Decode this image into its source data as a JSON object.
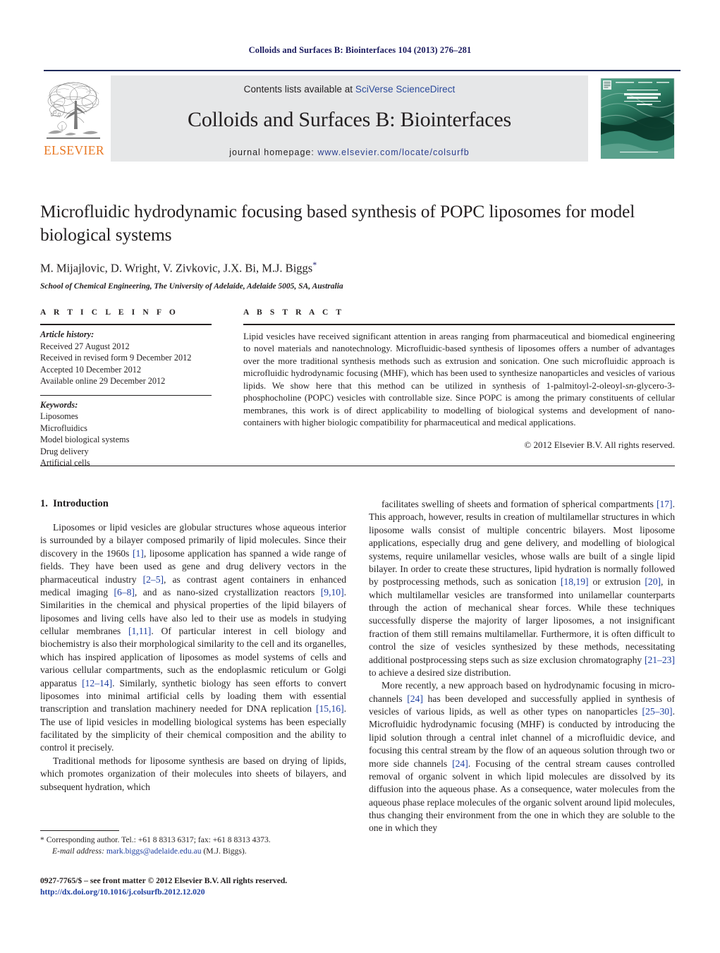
{
  "running_head": "Colloids and Surfaces B: Biointerfaces 104 (2013) 276–281",
  "masthead": {
    "publisher_name": "ELSEVIER",
    "contents_prefix": "Contents lists available at ",
    "contents_link": "SciVerse ScienceDirect",
    "journal_title": "Colloids and Surfaces B: Biointerfaces",
    "homepage_prefix": "journal homepage: ",
    "homepage_url": "www.elsevier.com/locate/colsurfb",
    "cover_line1": "COLLOIDS AND",
    "cover_line2": "SURFACES B",
    "cover_line3": "Biointerfaces",
    "colors": {
      "elsevier_orange": "#E87722",
      "link_blue": "#2b4a9b",
      "banner_grey": "#e6e7e8",
      "rule_navy": "#1f2a5a",
      "cover_green": "#2e8b6f"
    }
  },
  "title": "Microfluidic hydrodynamic focusing based synthesis of POPC liposomes for model biological systems",
  "authors": "M. Mijajlovic, D. Wright, V. Zivkovic, J.X. Bi, M.J. Biggs",
  "corresponding_marker": "*",
  "affiliation": "School of Chemical Engineering, The University of Adelaide, Adelaide 5005, SA, Australia",
  "article_info": {
    "label": "A R T I C L E   I N F O",
    "history_heading": "Article history:",
    "history": [
      "Received 27 August 2012",
      "Received in revised form 9 December 2012",
      "Accepted 10 December 2012",
      "Available online 29 December 2012"
    ],
    "keywords_heading": "Keywords:",
    "keywords": [
      "Liposomes",
      "Microfluidics",
      "Model biological systems",
      "Drug delivery",
      "Artificial cells"
    ]
  },
  "abstract": {
    "label": "A B S T R A C T",
    "part1": "Lipid vesicles have received significant attention in areas ranging from pharmaceutical and biomedical engineering to novel materials and nanotechnology. Microfluidic-based synthesis of liposomes offers a number of advantages over the more traditional synthesis methods such as extrusion and sonication. One such microfluidic approach is microfluidic hydrodynamic focusing (MHF), which has been used to synthesize nanoparticles and vesicles of various lipids. We show here that this method can be utilized in synthesis of 1-palmitoyl-2-oleoyl-",
    "italic_token": "sn",
    "part2": "-glycero-3-phosphocholine (POPC) vesicles with controllable size. Since POPC is among the primary constituents of cellular membranes, this work is of direct applicability to modelling of biological systems and development of nano-containers with higher biologic compatibility for pharmaceutical and medical applications.",
    "copyright": "© 2012 Elsevier B.V. All rights reserved."
  },
  "body": {
    "section_number": "1.",
    "section_title": "Introduction",
    "left_paragraphs": [
      {
        "segments": [
          {
            "t": "Liposomes or lipid vesicles are globular structures whose aqueous interior is surrounded by a bilayer composed primarily of lipid molecules. Since their discovery in the 1960s "
          },
          {
            "t": "[1]",
            "cite": true
          },
          {
            "t": ", liposome application has spanned a wide range of fields. They have been used as gene and drug delivery vectors in the pharmaceutical industry "
          },
          {
            "t": "[2–5]",
            "cite": true
          },
          {
            "t": ", as contrast agent containers in enhanced medical imaging "
          },
          {
            "t": "[6–8]",
            "cite": true
          },
          {
            "t": ", and as nano-sized crystallization reactors "
          },
          {
            "t": "[9,10]",
            "cite": true
          },
          {
            "t": ". Similarities in the chemical and physical properties of the lipid bilayers of liposomes and living cells have also led to their use as models in studying cellular membranes "
          },
          {
            "t": "[1,11]",
            "cite": true
          },
          {
            "t": ". Of particular interest in cell biology and biochemistry is also their morphological similarity to the cell and its organelles, which has inspired application of liposomes as model systems of cells and various cellular compartments, such as the endoplasmic reticulum or Golgi apparatus "
          },
          {
            "t": "[12–14]",
            "cite": true
          },
          {
            "t": ". Similarly, synthetic biology has seen efforts to convert liposomes into minimal artificial cells by loading them with essential transcription and translation machinery needed for DNA replication "
          },
          {
            "t": "[15,16]",
            "cite": true
          },
          {
            "t": ". The use of lipid vesicles in modelling biological systems has been especially facilitated by the simplicity of their chemical composition and the ability to control it precisely."
          }
        ]
      },
      {
        "segments": [
          {
            "t": "Traditional methods for liposome synthesis are based on drying of lipids, which promotes organization of their molecules into sheets of bilayers, and subsequent hydration, which"
          }
        ]
      }
    ],
    "right_paragraphs": [
      {
        "segments": [
          {
            "t": "facilitates swelling of sheets and formation of spherical compartments "
          },
          {
            "t": "[17]",
            "cite": true
          },
          {
            "t": ". This approach, however, results in creation of multilamellar structures in which liposome walls consist of multiple concentric bilayers. Most liposome applications, especially drug and gene delivery, and modelling of biological systems, require unilamellar vesicles, whose walls are built of a single lipid bilayer. In order to create these structures, lipid hydration is normally followed by postprocessing methods, such as sonication "
          },
          {
            "t": "[18,19]",
            "cite": true
          },
          {
            "t": " or extrusion "
          },
          {
            "t": "[20]",
            "cite": true
          },
          {
            "t": ", in which multilamellar vesicles are transformed into unilamellar counterparts through the action of mechanical shear forces. While these techniques successfully disperse the majority of larger liposomes, a not insignificant fraction of them still remains multilamellar. Furthermore, it is often difficult to control the size of vesicles synthesized by these methods, necessitating additional postprocessing steps such as size exclusion chromatography "
          },
          {
            "t": "[21–23]",
            "cite": true
          },
          {
            "t": " to achieve a desired size distribution."
          }
        ]
      },
      {
        "segments": [
          {
            "t": "More recently, a new approach based on hydrodynamic focusing in micro-channels "
          },
          {
            "t": "[24]",
            "cite": true
          },
          {
            "t": " has been developed and successfully applied in synthesis of vesicles of various lipids, as well as other types on nanoparticles "
          },
          {
            "t": "[25–30]",
            "cite": true
          },
          {
            "t": ". Microfluidic hydrodynamic focusing (MHF) is conducted by introducing the lipid solution through a central inlet channel of a microfluidic device, and focusing this central stream by the flow of an aqueous solution through two or more side channels "
          },
          {
            "t": "[24]",
            "cite": true
          },
          {
            "t": ". Focusing of the central stream causes controlled removal of organic solvent in which lipid molecules are dissolved by its diffusion into the aqueous phase. As a consequence, water molecules from the aqueous phase replace molecules of the organic solvent around lipid molecules, thus changing their environment from the one in which they are soluble to the one in which they"
          }
        ]
      }
    ]
  },
  "footnote": {
    "corresponding": "* Corresponding author. Tel.: +61 8 8313 6317; fax: +61 8 8313 4373.",
    "email_label": "E-mail address:",
    "email": "mark.biggs@adelaide.edu.au",
    "email_suffix": "(M.J. Biggs).",
    "issn_line": "0927-7765/$ – see front matter © 2012 Elsevier B.V. All rights reserved.",
    "doi": "http://dx.doi.org/10.1016/j.colsurfb.2012.12.020"
  }
}
